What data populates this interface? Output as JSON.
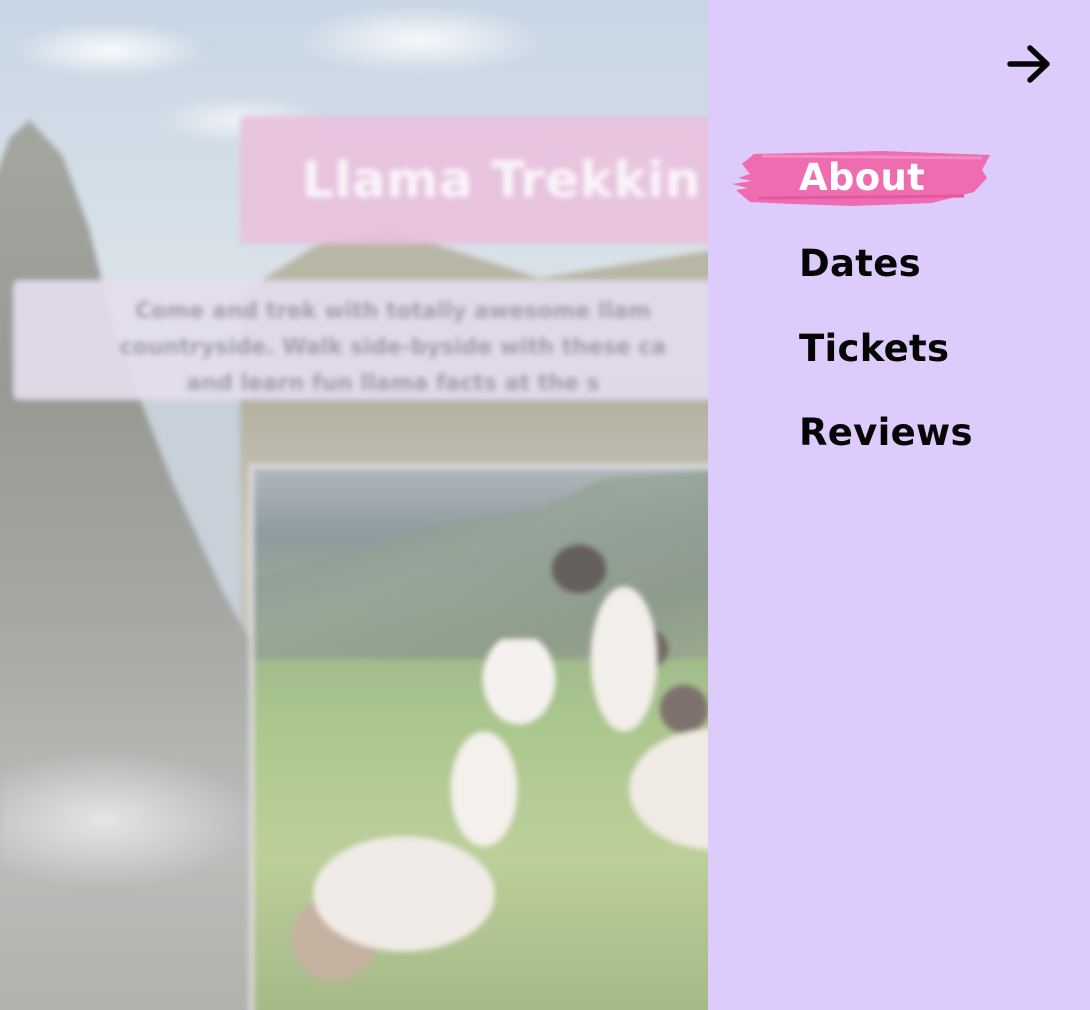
{
  "hero": {
    "title": "Llama Trekkin",
    "description_lines": [
      "Come and trek with totally awesome llam",
      "countryside. Walk side-byside with these ca",
      "and learn fun llama facts at the s"
    ]
  },
  "side_menu": {
    "close_icon": "arrow-right-icon",
    "items": [
      {
        "label": "About",
        "active": true
      },
      {
        "label": "Dates",
        "active": false
      },
      {
        "label": "Tickets",
        "active": false
      },
      {
        "label": "Reviews",
        "active": false
      }
    ],
    "colors": {
      "panel_background": "#dccbfb",
      "active_highlight": "#ee6cb0",
      "text": "#050505",
      "active_text": "#ffffff"
    }
  }
}
